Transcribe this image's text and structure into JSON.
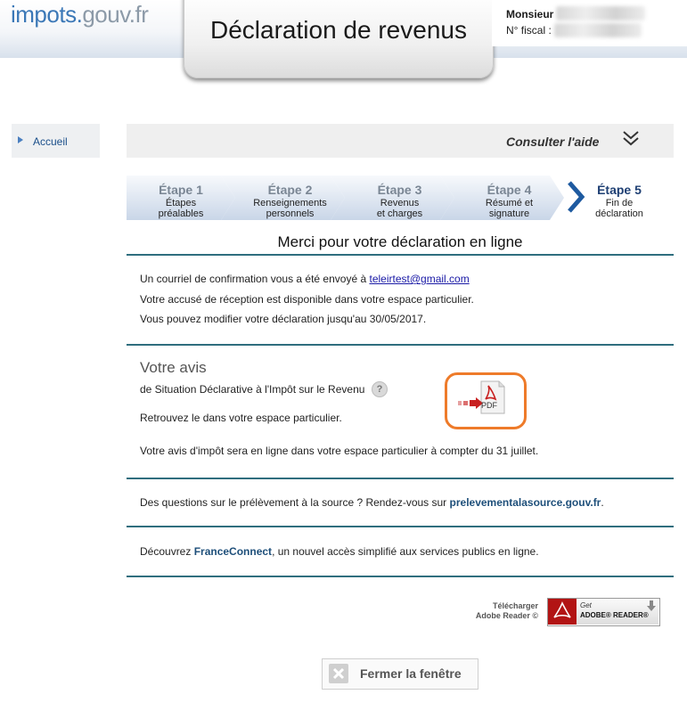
{
  "header": {
    "logo_part1": "impots.",
    "logo_part2": "gouv",
    "logo_part3": ".fr",
    "title": "Déclaration de revenus",
    "user_label": "Monsieur",
    "fiscal_label": "N° fiscal :"
  },
  "sidebar": {
    "home_label": "Accueil"
  },
  "help": {
    "label": "Consulter l'aide"
  },
  "steps": [
    {
      "num": "Étape 1",
      "desc1": "Étapes",
      "desc2": "préalables"
    },
    {
      "num": "Étape 2",
      "desc1": "Renseignements",
      "desc2": "personnels"
    },
    {
      "num": "Étape 3",
      "desc1": "Revenus",
      "desc2": "et charges"
    },
    {
      "num": "Étape 4",
      "desc1": "Résumé et",
      "desc2": "signature"
    },
    {
      "num": "Étape 5",
      "desc1": "Fin de",
      "desc2": "déclaration"
    }
  ],
  "main": {
    "heading": "Merci pour votre déclaration en ligne",
    "confirm_prefix": "Un courriel de confirmation vous a été envoyé à ",
    "email": "teleirtest@gmail.com",
    "receipt_line": "Votre accusé de réception est disponible dans votre espace particulier.",
    "modify_line": "Vous pouvez modifier votre déclaration jusqu'au 30/05/2017.",
    "avis_title": "Votre avis",
    "avis_sub": "de Situation Déclarative à l'Impôt sur le Revenu",
    "help_q": "?",
    "pdf_label": "PDF",
    "retrouvez": "Retrouvez le dans votre espace particulier.",
    "avis_online": "Votre avis d'impôt sera en ligne dans votre espace particulier à compter du 31 juillet.",
    "prelevement_prefix": "Des questions sur le prélèvement à la source ? Rendez-vous sur ",
    "prelevement_link": "prelevementalasource.gouv.fr",
    "prelevement_suffix": ".",
    "fc_prefix": "Découvrez ",
    "fc_link": "FranceConnect",
    "fc_suffix": ", un nouvel accès simplifié aux services publics en ligne."
  },
  "adobe": {
    "download_line1": "Télécharger",
    "download_line2": "Adobe Reader ©",
    "get": "Get",
    "reader": "ADOBE® READER®"
  },
  "close_button": {
    "label": "Fermer la fenêtre"
  },
  "colors": {
    "accent": "#2f6e7e",
    "brand_blue": "#3b78b7",
    "pdf_border": "#ee7b2a",
    "active_step": "#1e3f73"
  }
}
